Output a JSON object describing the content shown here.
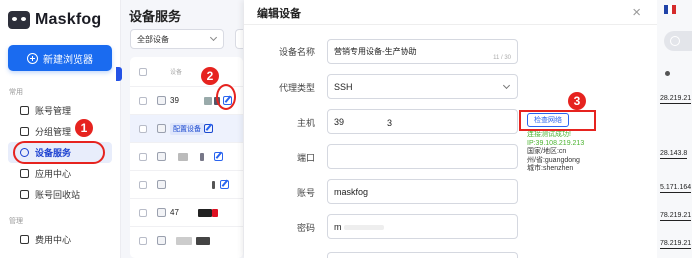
{
  "app": {
    "name": "Maskfog",
    "new_browser_label": "新建浏览器"
  },
  "sidebar": {
    "section_common": "常用",
    "section_manage": "管理",
    "items": [
      {
        "label": "账号管理",
        "icon": "user-icon"
      },
      {
        "label": "分组管理",
        "icon": "folder-icon"
      },
      {
        "label": "设备服务",
        "icon": "globe-icon",
        "active": true
      },
      {
        "label": "应用中心",
        "icon": "grid-icon"
      },
      {
        "label": "账号回收站",
        "icon": "trash-icon"
      },
      {
        "label": "费用中心",
        "icon": "wallet-icon"
      }
    ]
  },
  "device_list": {
    "title": "设备服务",
    "filter_value": "全部设备",
    "header_label": "设备",
    "rows": [
      {
        "name": "39"
      },
      {
        "tag": "配置设备"
      },
      {
        "name": ""
      },
      {
        "name": ""
      },
      {
        "name": "47"
      },
      {
        "name": ""
      }
    ]
  },
  "modal": {
    "title": "编辑设备",
    "close_label": "×",
    "fields": {
      "device_name": {
        "label": "设备名称",
        "value": "营销专用设备-生产协助",
        "counter": "11 / 30"
      },
      "proxy_type": {
        "label": "代理类型",
        "value": "SSH"
      },
      "host": {
        "label": "主机",
        "value": "39",
        "value_tail": "3"
      },
      "port": {
        "label": "端口",
        "value": ""
      },
      "account": {
        "label": "账号",
        "value": "maskfog"
      },
      "password": {
        "label": "密码",
        "value": "m"
      }
    },
    "check_button": "检查网络",
    "result": {
      "status": "连接测试成功!",
      "ip": "IP:39.108.219.213",
      "country": "国家/地区:cn",
      "province": "州/省:guangdong",
      "city": "城市:shenzhen"
    }
  },
  "annotations": {
    "step1": "1",
    "step2": "2",
    "step3": "3"
  },
  "background_right": {
    "ip_fragments": [
      "28.219.21",
      "28.143.8",
      "5.171.164",
      "78.219.21",
      "78.219.21"
    ]
  },
  "colors": {
    "accent": "#1a6bf0",
    "annotation_red": "#e6231f",
    "success_green": "#4bb330"
  }
}
